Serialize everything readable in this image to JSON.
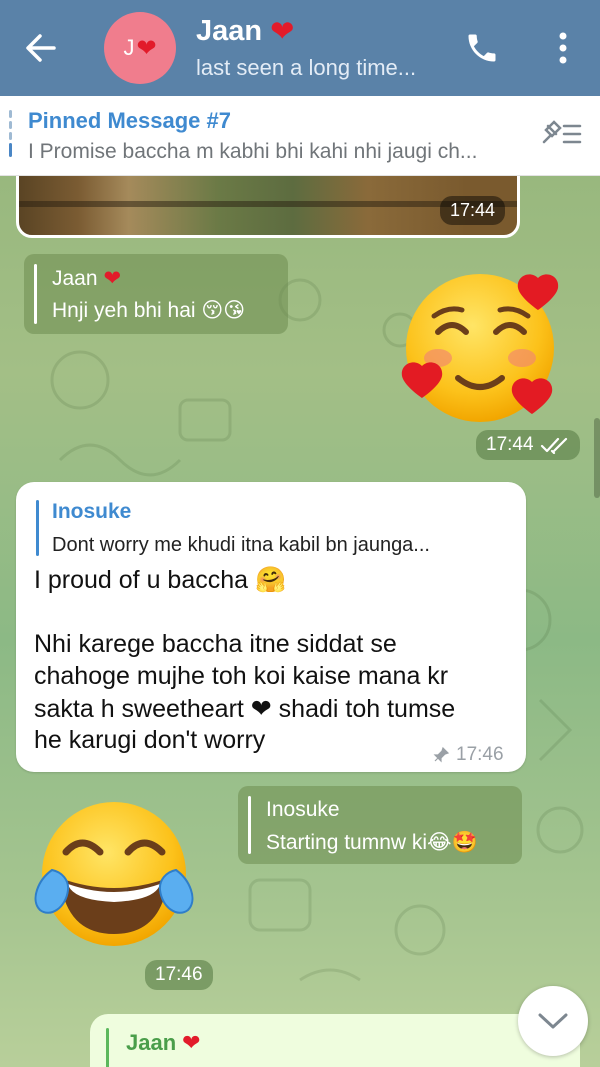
{
  "header": {
    "avatar_initial": "J",
    "avatar_heart": "❤",
    "name": "Jaan",
    "name_heart": "❤",
    "status": "last seen a long time..."
  },
  "pinned": {
    "title": "Pinned Message #7",
    "text": "I Promise baccha m kabhi bhi kahi nhi jaugi ch..."
  },
  "photo_message": {
    "time": "17:44"
  },
  "msg_reply_jaan": {
    "name": "Jaan",
    "heart": "❤",
    "text": "Hnji yeh bhi hai 😚😘"
  },
  "sticker_blush": {
    "icon": "smiling-face-with-hearts-sticker",
    "time": "17:44"
  },
  "msg_inosuke": {
    "reply_name": "Inosuke",
    "reply_text": "Dont worry me khudi itna kabil bn jaunga...",
    "lines": [
      "I proud of u baccha 🤗",
      "",
      "Nhi karege baccha itne siddat se",
      "chahoge mujhe toh koi kaise mana kr",
      "sakta h sweetheart ❤ shadi toh tumse",
      "he karugi don't worry"
    ],
    "time": "17:46"
  },
  "msg_reply_inosuke": {
    "name": "Inosuke",
    "text": "Starting tumnw ki😂🤩"
  },
  "sticker_laugh": {
    "icon": "tears-of-joy-sticker",
    "time": "17:46"
  },
  "bottom_message": {
    "name": "Jaan",
    "heart": "❤"
  },
  "colors": {
    "header_bg": "#5a82a8",
    "accent_blue": "#3f8ad0",
    "incoming_bubble": "#ffffff",
    "outgoing_bubble": "#effdde"
  }
}
